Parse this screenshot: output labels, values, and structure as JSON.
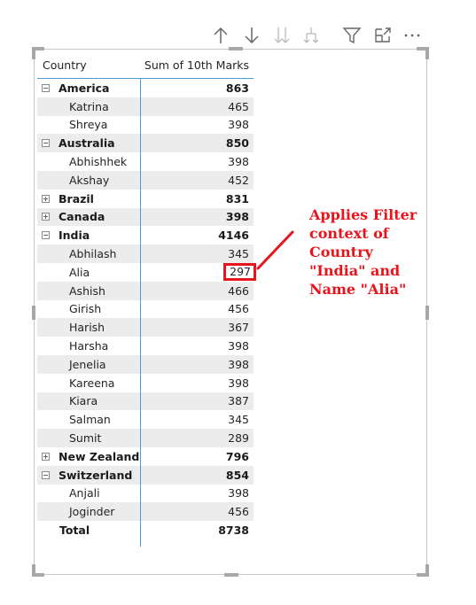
{
  "toolbar": {
    "icons": [
      "sort-ascending-icon",
      "sort-descending-icon",
      "expand-all-down-icon",
      "expand-next-level-icon",
      "filter-icon",
      "focus-mode-icon",
      "more-options-icon"
    ]
  },
  "matrix": {
    "headers": {
      "row": "Country",
      "value": "Sum of 10th Marks"
    },
    "rows": [
      {
        "type": "group",
        "expanded": true,
        "label": "America",
        "value": "863"
      },
      {
        "type": "child",
        "label": "Katrina",
        "value": "465"
      },
      {
        "type": "child",
        "label": "Shreya",
        "value": "398"
      },
      {
        "type": "group",
        "expanded": true,
        "label": "Australia",
        "value": "850"
      },
      {
        "type": "child",
        "label": "Abhishhek",
        "value": "398"
      },
      {
        "type": "child",
        "label": "Akshay",
        "value": "452"
      },
      {
        "type": "group",
        "expanded": false,
        "label": "Brazil",
        "value": "831"
      },
      {
        "type": "group",
        "expanded": false,
        "label": "Canada",
        "value": "398"
      },
      {
        "type": "group",
        "expanded": true,
        "label": "India",
        "value": "4146"
      },
      {
        "type": "child",
        "label": "Abhilash",
        "value": "345"
      },
      {
        "type": "child",
        "label": "Alia",
        "value": "297",
        "highlight": true
      },
      {
        "type": "child",
        "label": "Ashish",
        "value": "466"
      },
      {
        "type": "child",
        "label": "Girish",
        "value": "456"
      },
      {
        "type": "child",
        "label": "Harish",
        "value": "367"
      },
      {
        "type": "child",
        "label": "Harsha",
        "value": "398"
      },
      {
        "type": "child",
        "label": "Jenelia",
        "value": "398"
      },
      {
        "type": "child",
        "label": "Kareena",
        "value": "398"
      },
      {
        "type": "child",
        "label": "Kiara",
        "value": "387"
      },
      {
        "type": "child",
        "label": "Salman",
        "value": "345"
      },
      {
        "type": "child",
        "label": "Sumit",
        "value": "289"
      },
      {
        "type": "group",
        "expanded": false,
        "label": "New Zealand",
        "value": "796"
      },
      {
        "type": "group",
        "expanded": true,
        "label": "Switzerland",
        "value": "854"
      },
      {
        "type": "child",
        "label": "Anjali",
        "value": "398"
      },
      {
        "type": "child",
        "label": "Joginder",
        "value": "456"
      }
    ],
    "total": {
      "label": "Total",
      "value": "8738"
    }
  },
  "annotation": {
    "lines": [
      "Applies Filter",
      "context of",
      "Country",
      "\"India\" and",
      "Name \"Alia\""
    ],
    "color": "#e8141c"
  },
  "colors": {
    "accent_line": "#4a9bd6",
    "stripe": "#ececec",
    "highlight": "#e8141c"
  }
}
